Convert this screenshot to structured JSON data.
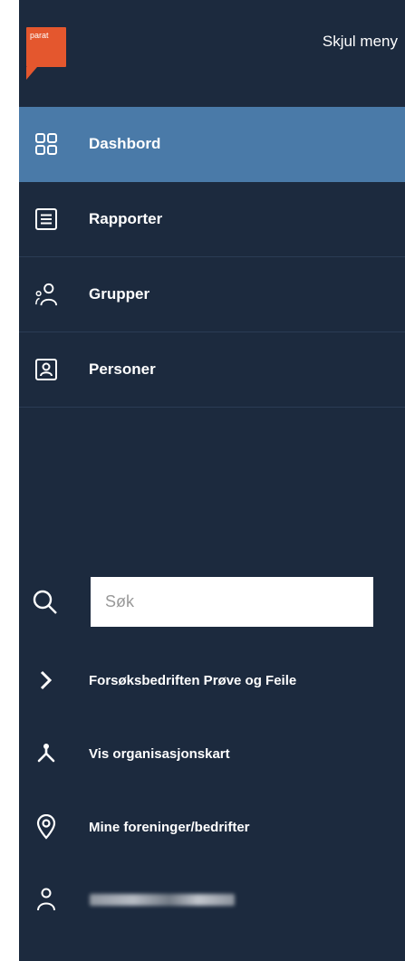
{
  "header": {
    "logo_text": "parat",
    "hide_menu_label": "Skjul meny"
  },
  "nav": {
    "items": [
      {
        "label": "Dashbord",
        "icon": "grid-icon",
        "active": true
      },
      {
        "label": "Rapporter",
        "icon": "document-list-icon",
        "active": false
      },
      {
        "label": "Grupper",
        "icon": "group-icon",
        "active": false
      },
      {
        "label": "Personer",
        "icon": "person-card-icon",
        "active": false
      }
    ]
  },
  "search": {
    "placeholder": "Søk",
    "value": ""
  },
  "links": {
    "org_name": "Forsøksbedriften Prøve og Feile",
    "org_chart": "Vis organisasjonskart",
    "my_unions": "Mine foreninger/bedrifter"
  },
  "user": {
    "icon": "user-icon",
    "name_redacted": true
  },
  "colors": {
    "panel_bg": "#1c2a3e",
    "active_bg": "#4a7aa8",
    "logo": "#e4572e",
    "divider": "#2b3c55"
  }
}
